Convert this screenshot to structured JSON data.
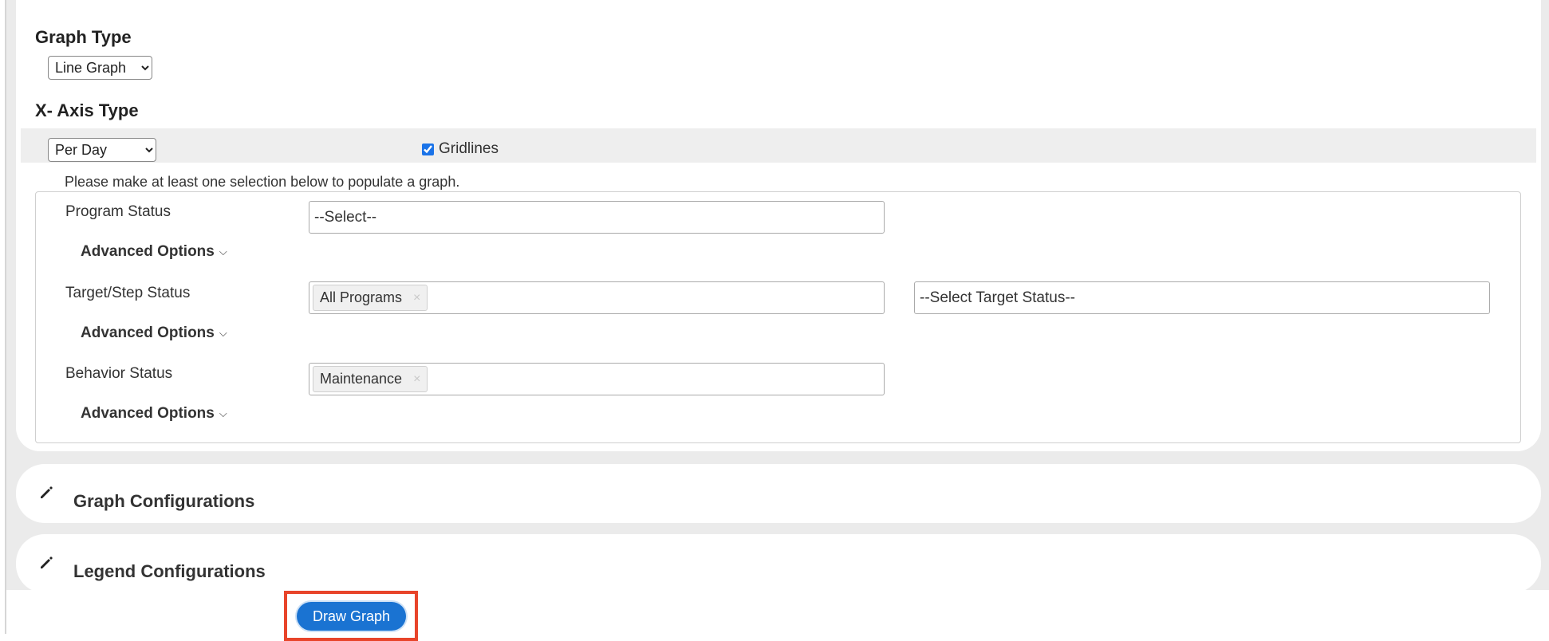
{
  "graph_type": {
    "title": "Graph Type",
    "selected": "Line Graph"
  },
  "x_axis_type": {
    "title": "X- Axis Type",
    "selected": "Per Day",
    "gridlines_label": "Gridlines",
    "gridlines_checked": true
  },
  "selection_note": "Please make at least one selection below to populate a graph.",
  "rows": [
    {
      "label": "Program Status",
      "placeholder": "--Select--",
      "advanced": "Advanced Options"
    },
    {
      "label": "Target/Step Status",
      "chip": "All Programs",
      "chip_remove": "×",
      "extra_placeholder": "--Select Target Status--",
      "advanced": "Advanced Options"
    },
    {
      "label": "Behavior Status",
      "chip": "Maintenance",
      "chip_remove": "×",
      "advanced": "Advanced Options"
    }
  ],
  "sections": {
    "graph_config": "Graph Configurations",
    "legend_config": "Legend Configurations"
  },
  "draw_button": "Draw Graph",
  "colors": {
    "button": "#1a73d2",
    "highlight_outline": "#e8442a",
    "checkbox_accent": "#1a73e8"
  },
  "icons": {
    "section_icon": "pencil-icon",
    "expand_icon": "chevron-down-icon"
  }
}
